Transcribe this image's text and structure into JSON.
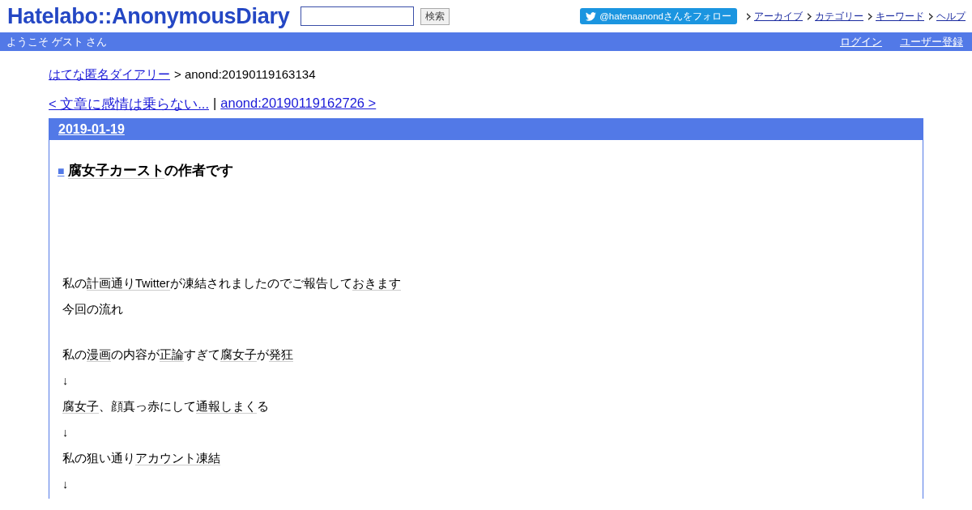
{
  "header": {
    "logo": "Hatelabo::AnonymousDiary",
    "search": {
      "button": "検索"
    },
    "follow": "@hatenaanondさんをフォロー",
    "nav": [
      "アーカイブ",
      "カテゴリー",
      "キーワード",
      "ヘルプ"
    ]
  },
  "userbar": {
    "welcome": "ようこそ ゲスト さん",
    "links": [
      "ログイン",
      "ユーザー登録"
    ]
  },
  "breadcrumb": {
    "home": "はてな匿名ダイアリー",
    "current": "> anond:20190119163134"
  },
  "pager": {
    "prev": "< 文章に感情は乗らない...",
    "separator": "|",
    "next": "anond:20190119162726 >"
  },
  "entry": {
    "date": "2019-01-19",
    "title_mark": "■",
    "title": [
      {
        "text": "腐女子カースト",
        "keyword": true
      },
      {
        "text": "の作者です",
        "keyword": false
      }
    ],
    "paragraphs": [
      [
        {
          "text": "私の",
          "keyword": false
        },
        {
          "text": "計画通りTwitter",
          "keyword": true
        },
        {
          "text": "が凍結されましたのでご報告して",
          "keyword": false
        },
        {
          "text": "おきます",
          "keyword": true
        }
      ],
      [
        {
          "text": "今回の流れ",
          "keyword": false
        }
      ],
      [
        {
          "text": "私の",
          "keyword": false
        },
        {
          "text": "漫画",
          "keyword": true
        },
        {
          "text": "の内容が",
          "keyword": false
        },
        {
          "text": "正論",
          "keyword": true
        },
        {
          "text": "すぎて",
          "keyword": false
        },
        {
          "text": "腐女子",
          "keyword": true
        },
        {
          "text": "が",
          "keyword": false
        },
        {
          "text": "発狂",
          "keyword": true
        }
      ],
      [
        {
          "text": "↓",
          "keyword": false
        }
      ],
      [
        {
          "text": "腐女子",
          "keyword": true
        },
        {
          "text": "、顔真っ赤にして",
          "keyword": false
        },
        {
          "text": "通報しまく",
          "keyword": true
        },
        {
          "text": "る",
          "keyword": false
        }
      ],
      [
        {
          "text": "↓",
          "keyword": false
        }
      ],
      [
        {
          "text": "私の狙い通り",
          "keyword": false
        },
        {
          "text": "アカウント凍結",
          "keyword": true
        }
      ],
      [
        {
          "text": "↓",
          "keyword": false
        }
      ]
    ]
  }
}
